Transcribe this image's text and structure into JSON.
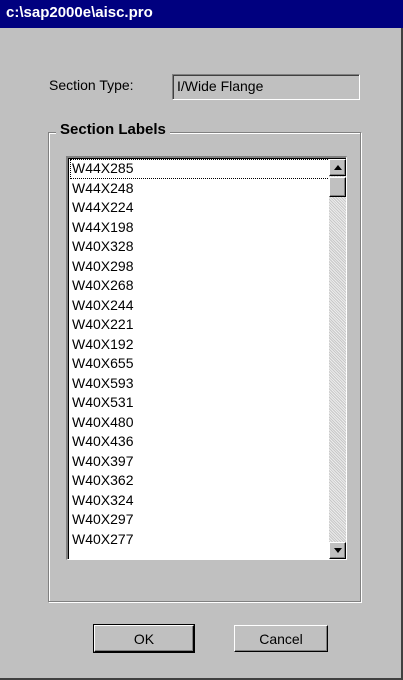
{
  "window": {
    "title": "c:\\sap2000e\\aisc.pro"
  },
  "section_type": {
    "label": "Section Type:",
    "value": "I/Wide Flange"
  },
  "section_labels": {
    "group_label": "Section Labels",
    "items": [
      "W44X285",
      "W44X248",
      "W44X224",
      "W44X198",
      "W40X328",
      "W40X298",
      "W40X268",
      "W40X244",
      "W40X221",
      "W40X192",
      "W40X655",
      "W40X593",
      "W40X531",
      "W40X480",
      "W40X436",
      "W40X397",
      "W40X362",
      "W40X324",
      "W40X297",
      "W40X277"
    ],
    "selected_index": 0
  },
  "buttons": {
    "ok_label": "OK",
    "cancel_label": "Cancel"
  },
  "colors": {
    "title_bar": "#00007f",
    "dialog_bg": "#c0c0c0"
  }
}
